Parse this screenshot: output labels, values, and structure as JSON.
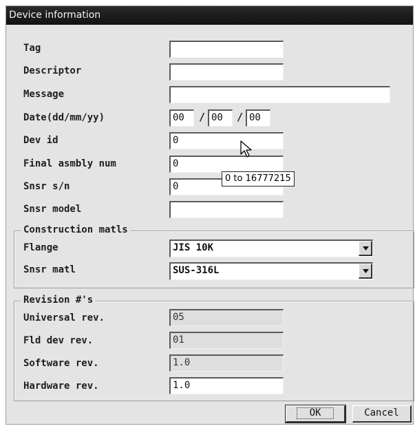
{
  "window": {
    "title": "Device information"
  },
  "fields": {
    "tag": {
      "label": "Tag",
      "value": ""
    },
    "descriptor": {
      "label": "Descriptor",
      "value": ""
    },
    "message": {
      "label": "Message",
      "value": ""
    },
    "date": {
      "label": "Date(dd/mm/yy)",
      "dd": "00",
      "mm": "00",
      "yy": "00",
      "separator": "/"
    },
    "dev_id": {
      "label": "Dev id",
      "value": "0"
    },
    "final_asmbly_num": {
      "label": "Final asmbly num",
      "value": "0"
    },
    "snsr_sn": {
      "label": "Snsr s/n",
      "value": "0"
    },
    "snsr_model": {
      "label": "Snsr model",
      "value": ""
    }
  },
  "tooltip": {
    "text": "0 to 16777215"
  },
  "construction": {
    "title": "Construction matls",
    "flange": {
      "label": "Flange",
      "value": "JIS 10K"
    },
    "snsr_matl": {
      "label": "Snsr matl",
      "value": "SUS-316L"
    }
  },
  "revision": {
    "title": "Revision #'s",
    "universal": {
      "label": "Universal rev.",
      "value": "05"
    },
    "fld_dev": {
      "label": "Fld dev rev.",
      "value": "01"
    },
    "software": {
      "label": "Software rev.",
      "value": "1.0"
    },
    "hardware": {
      "label": "Hardware rev.",
      "value": "1.0"
    }
  },
  "buttons": {
    "ok": "OK",
    "cancel": "Cancel"
  },
  "icons": {
    "cursor": "mouse-pointer-icon",
    "dropdown": "chevron-down-icon"
  }
}
